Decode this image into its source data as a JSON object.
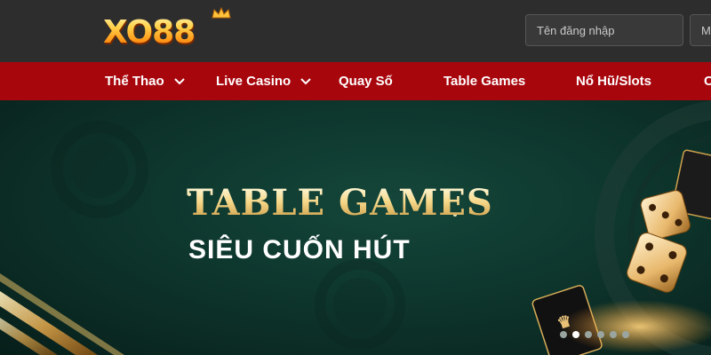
{
  "header": {
    "logo_text": "XO88",
    "username_placeholder": "Tên đăng nhập",
    "password_placeholder": "M"
  },
  "nav": {
    "items": [
      {
        "label": "Thể Thao",
        "has_dropdown": true
      },
      {
        "label": "Live Casino",
        "has_dropdown": true
      },
      {
        "label": "Quay Số",
        "has_dropdown": false
      },
      {
        "label": "Table Games",
        "has_dropdown": false
      },
      {
        "label": "Nổ Hũ/Slots",
        "has_dropdown": false
      },
      {
        "label": "C",
        "has_dropdown": false
      }
    ]
  },
  "banner": {
    "title": "TABLE GAMES",
    "subtitle": "SIÊU CUỐN HÚT",
    "slide_count": 6,
    "active_slide": 1
  },
  "colors": {
    "header_bg": "#2e2d2d",
    "nav_bg": "#a8060d",
    "hero_bg": "#0f3a30",
    "gold": "#f6d88a"
  }
}
